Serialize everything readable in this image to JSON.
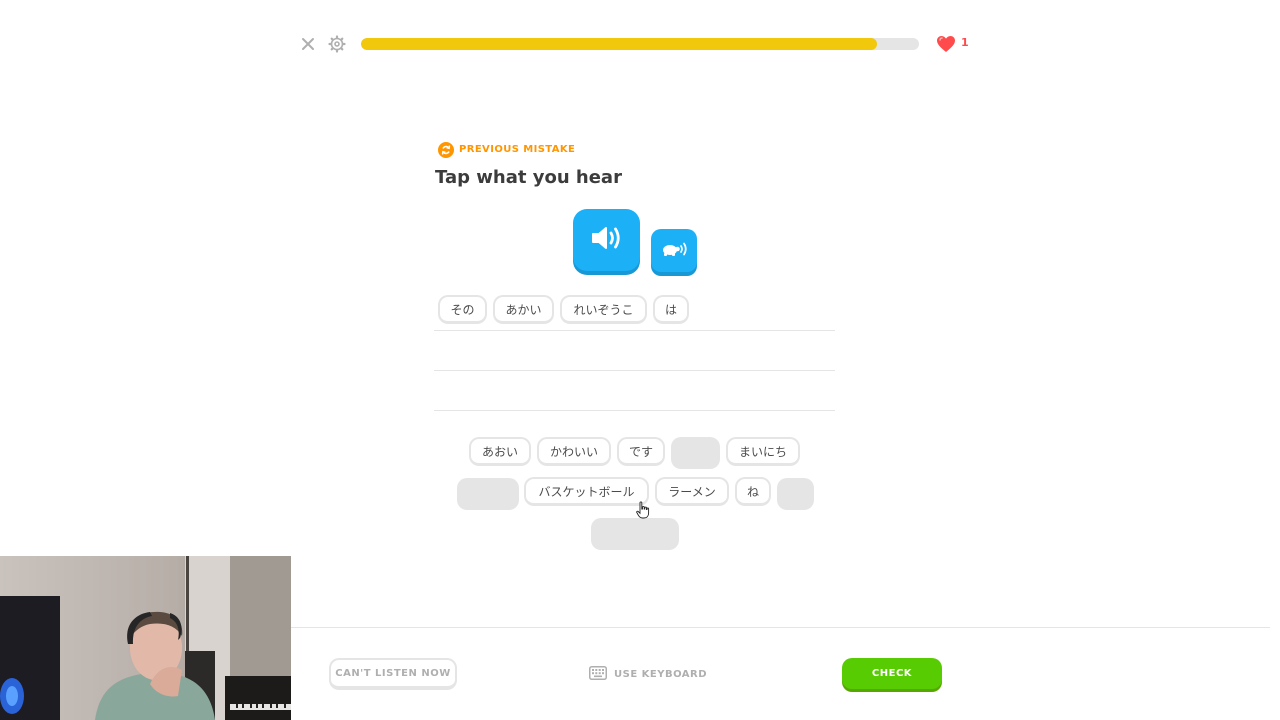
{
  "top_bar": {
    "close_icon": "close-icon",
    "settings_icon": "gear-icon",
    "progress": 0.925,
    "hearts": "1",
    "heart_color": "#ff4b4b",
    "progress_color": "#f2c80d"
  },
  "challenge": {
    "tag": "PREVIOUS MISTAKE",
    "instruction": "Tap what you hear",
    "audio_icon": "speaker-icon",
    "slow_audio_icon": "turtle-speaker-icon"
  },
  "answer_tokens": [
    "その",
    "あかい",
    "れいぞうこ",
    "は"
  ],
  "word_bank": {
    "row1": [
      "あおい",
      "かわいい",
      "です",
      "",
      "まいにち"
    ],
    "row2": [
      "",
      "バスケットボール",
      "ラーメン",
      "ね",
      ""
    ],
    "row3": [
      ""
    ]
  },
  "footer": {
    "cant_listen": "CAN'T LISTEN NOW",
    "use_keyboard": "USE KEYBOARD",
    "check": "CHECK",
    "check_color": "#58cc02"
  },
  "colors": {
    "accent_blue": "#1cb0f6",
    "mistake_orange": "#ff9600"
  }
}
